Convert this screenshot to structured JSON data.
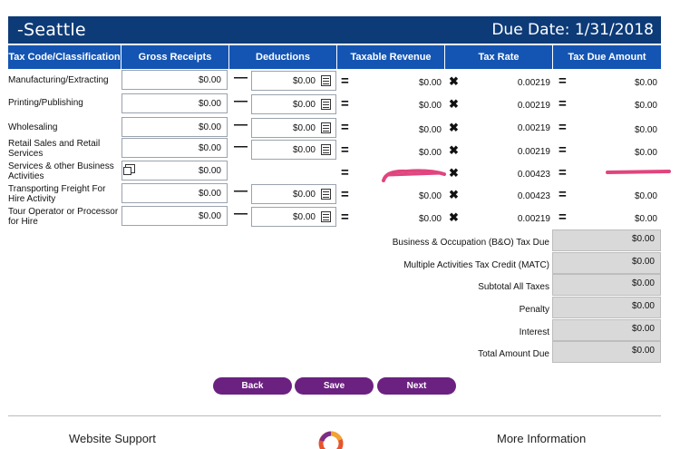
{
  "header": {
    "city": "-Seattle",
    "due_date": "Due Date: 1/31/2018"
  },
  "columns": {
    "tax_code": "Tax Code/Classification",
    "gross": "Gross Receipts",
    "deductions": "Deductions",
    "taxable": "Taxable Revenue",
    "rate": "Tax Rate",
    "due": "Tax Due Amount"
  },
  "rows": [
    {
      "label": "Manufacturing/Extracting",
      "gross": "$0.00",
      "deduction": "$0.00",
      "taxable": "$0.00",
      "rate": "0.00219",
      "due": "$0.00"
    },
    {
      "label": "Printing/Publishing",
      "gross": "$0.00",
      "deduction": "$0.00",
      "taxable": "$0.00",
      "rate": "0.00219",
      "due": "$0.00"
    },
    {
      "label": "Wholesaling",
      "gross": "$0.00",
      "deduction": "$0.00",
      "taxable": "$0.00",
      "rate": "0.00219",
      "due": "$0.00"
    },
    {
      "label": "Retail Sales and Retail Services",
      "gross": "$0.00",
      "deduction": "$0.00",
      "taxable": "$0.00",
      "rate": "0.00219",
      "due": "$0.00"
    },
    {
      "label": "Services & other Business Activities",
      "gross": "$0.00",
      "deduction": "",
      "taxable": "",
      "rate": "0.00423",
      "due": ""
    },
    {
      "label": "Transporting Freight For Hire Activity",
      "gross": "$0.00",
      "deduction": "$0.00",
      "taxable": "$0.00",
      "rate": "0.00423",
      "due": "$0.00"
    },
    {
      "label": "Tour Operator or Processor for Hire",
      "gross": "$0.00",
      "deduction": "$0.00",
      "taxable": "$0.00",
      "rate": "0.00219",
      "due": "$0.00"
    }
  ],
  "summary": [
    {
      "label": "Business & Occupation (B&O) Tax Due",
      "value": "$0.00"
    },
    {
      "label": "Multiple Activities Tax Credit (MATC)",
      "value": "$0.00"
    },
    {
      "label": "Subtotal All Taxes",
      "value": "$0.00"
    },
    {
      "label": "Penalty",
      "value": "$0.00"
    },
    {
      "label": "Interest",
      "value": "$0.00"
    },
    {
      "label": "Total Amount Due",
      "value": "$0.00"
    }
  ],
  "buttons": {
    "back": "Back",
    "save": "Save",
    "next": "Next"
  },
  "footer": {
    "support": "Website Support",
    "more": "More Information"
  },
  "symbols": {
    "minus": "—",
    "equals": "=",
    "times": "✖"
  },
  "icons": {
    "calculator": "calculator-icon",
    "notes": "notes-icon",
    "logo": "logo-icon"
  },
  "colors": {
    "title_bar": "#0d3b78",
    "header": "#1455b3",
    "button": "#6b2180",
    "redaction": "#e0457e"
  }
}
